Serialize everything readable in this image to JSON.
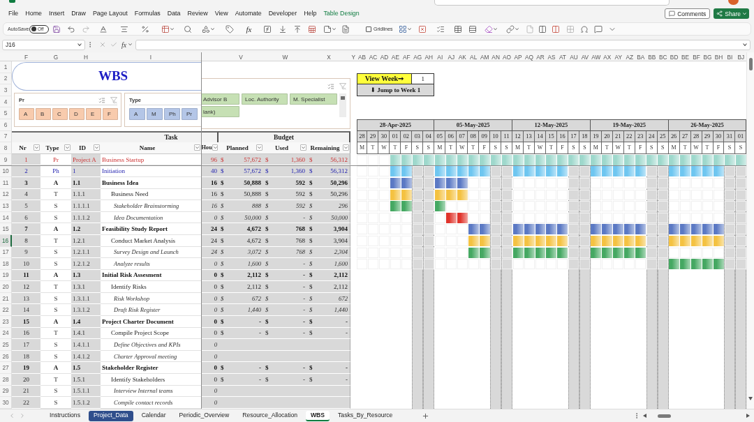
{
  "menu": {
    "tabs": [
      {
        "label": "File",
        "selected": false,
        "kind": "standard"
      },
      {
        "label": "Home",
        "selected": false,
        "kind": "standard"
      },
      {
        "label": "Insert",
        "selected": false,
        "kind": "standard"
      },
      {
        "label": "Draw",
        "selected": false,
        "kind": "standard"
      },
      {
        "label": "Page Layout",
        "selected": false,
        "kind": "standard"
      },
      {
        "label": "Formulas",
        "selected": false,
        "kind": "standard"
      },
      {
        "label": "Data",
        "selected": false,
        "kind": "standard"
      },
      {
        "label": "Review",
        "selected": false,
        "kind": "standard"
      },
      {
        "label": "View",
        "selected": false,
        "kind": "standard"
      },
      {
        "label": "Automate",
        "selected": false,
        "kind": "standard"
      },
      {
        "label": "Developer",
        "selected": false,
        "kind": "standard"
      },
      {
        "label": "Help",
        "selected": false,
        "kind": "standard"
      },
      {
        "label": "Table Design",
        "selected": false,
        "kind": "contextual"
      }
    ]
  },
  "header_buttons": [
    {
      "kind": "comments",
      "label": "Comments"
    },
    {
      "kind": "share",
      "label": "Share"
    }
  ],
  "toolbar": {
    "autosave": {
      "label": "AutoSave",
      "state": "Off",
      "on": false
    },
    "function_label": "fx",
    "gridlines": {
      "label": "Gridlines",
      "checked": false
    }
  },
  "formula_bar": {
    "name_box": "J16",
    "function_label": "fx"
  },
  "column_headers": [
    "F",
    "G",
    "H",
    "I",
    "V",
    "W",
    "X",
    "Y",
    "AB",
    "AC",
    "AD",
    "AE",
    "AF",
    "AG",
    "AH",
    "AI",
    "AJ",
    "AK",
    "AL",
    "AM",
    "AN",
    "AO",
    "AP",
    "AQ",
    "AR",
    "AS",
    "AT",
    "AU",
    "AV",
    "AW",
    "AX",
    "AY",
    "AZ",
    "BA",
    "BB",
    "BC",
    "BD",
    "BE",
    "BF",
    "BG",
    "BH",
    "BI",
    "BJ"
  ],
  "row_headers": [
    {
      "label": "1",
      "selected": false
    },
    {
      "label": "2",
      "selected": false
    },
    {
      "label": "3",
      "selected": false
    },
    {
      "label": "4",
      "selected": false
    },
    {
      "label": "5",
      "selected": false
    },
    {
      "label": "6",
      "selected": false
    },
    {
      "label": "7",
      "selected": false
    },
    {
      "label": "8",
      "selected": false
    },
    {
      "label": "9",
      "selected": false
    },
    {
      "label": "10",
      "selected": false
    },
    {
      "label": "11",
      "selected": false
    },
    {
      "label": "12",
      "selected": false
    },
    {
      "label": "13",
      "selected": false
    },
    {
      "label": "14",
      "selected": false
    },
    {
      "label": "15",
      "selected": false
    },
    {
      "label": "16",
      "selected": true
    },
    {
      "label": "17",
      "selected": false
    },
    {
      "label": "18",
      "selected": false
    },
    {
      "label": "19",
      "selected": false
    },
    {
      "label": "20",
      "selected": false
    },
    {
      "label": "21",
      "selected": false
    },
    {
      "label": "22",
      "selected": false
    },
    {
      "label": "23",
      "selected": false
    },
    {
      "label": "24",
      "selected": false
    },
    {
      "label": "25",
      "selected": false
    },
    {
      "label": "26",
      "selected": false
    },
    {
      "label": "27",
      "selected": false
    },
    {
      "label": "28",
      "selected": false
    },
    {
      "label": "29",
      "selected": false
    },
    {
      "label": "30",
      "selected": false
    }
  ],
  "title": "WBS",
  "slicers": [
    {
      "title": "Pr",
      "color": "#f8cbad",
      "items": [
        {
          "label": "A",
          "selected": true
        },
        {
          "label": "B",
          "selected": true
        },
        {
          "label": "C",
          "selected": true
        },
        {
          "label": "D",
          "selected": true
        },
        {
          "label": "E",
          "selected": true
        },
        {
          "label": "F",
          "selected": true
        }
      ]
    },
    {
      "title": "Type",
      "color": "#b4c6e7",
      "items": [
        {
          "label": "A",
          "selected": true
        },
        {
          "label": "M",
          "selected": true
        },
        {
          "label": "Ph",
          "selected": true
        },
        {
          "label": "Pr",
          "selected": true
        }
      ]
    },
    {
      "color": "#c6e0b4",
      "items": [
        {
          "label": "Advisor B",
          "selected": true
        },
        {
          "label": "Loc. Authority",
          "selected": true
        },
        {
          "label": "M. Specialist",
          "selected": true
        },
        {
          "label": "lank)",
          "selected": true
        }
      ]
    }
  ],
  "view_week": {
    "label": "View Week➞",
    "value": "1",
    "jump": "⬇ Jump to Week 1"
  },
  "table": {
    "groups": [
      {
        "label": "Task"
      },
      {
        "label": "Budget"
      }
    ],
    "columns": [
      {
        "label": "Nr"
      },
      {
        "label": "Type"
      },
      {
        "label": "ID"
      },
      {
        "label": "Name"
      },
      {
        "label": "Hou"
      },
      {
        "label": "Planned"
      },
      {
        "label": "Used"
      },
      {
        "label": "Remaining"
      }
    ],
    "rows": [
      {
        "kind": "project",
        "nr": "1",
        "type": "Pr",
        "id": "Project A",
        "name": "Business Startup",
        "hours": "96",
        "planned": {
          "symbol": "$",
          "amount": "57,672"
        },
        "used": {
          "symbol": "$",
          "amount": "1,360"
        },
        "remaining": {
          "symbol": "$",
          "amount": "56,312"
        },
        "bar": {
          "color": "#9ed8cc",
          "days": [
            false,
            false,
            false,
            true,
            true,
            true,
            true,
            true,
            true,
            true,
            true,
            true,
            true,
            true,
            true,
            true,
            true,
            true,
            true,
            true,
            true,
            true,
            true,
            true,
            true,
            true,
            true,
            true,
            true,
            true,
            true,
            true,
            true,
            true,
            true
          ]
        }
      },
      {
        "kind": "phase",
        "nr": "2",
        "type": "Ph",
        "id": "1",
        "name": "Initiation",
        "hours": "40",
        "planned": {
          "symbol": "$",
          "amount": "57,672"
        },
        "used": {
          "symbol": "$",
          "amount": "1,360"
        },
        "remaining": {
          "symbol": "$",
          "amount": "56,312"
        },
        "bar": {
          "color": "#6ec6f0",
          "days": [
            false,
            false,
            false,
            true,
            true,
            false,
            false,
            true,
            true,
            true,
            true,
            true,
            false,
            false,
            true,
            true,
            true,
            true,
            true,
            false,
            false,
            true,
            true,
            true,
            true,
            true,
            false,
            false,
            true,
            true,
            true,
            true,
            true,
            false,
            false
          ]
        }
      },
      {
        "kind": "activity",
        "nr": "3",
        "type": "A",
        "id": "1.1",
        "name": "Business Idea",
        "hours": "16",
        "planned": {
          "symbol": "$",
          "amount": "50,888"
        },
        "used": {
          "symbol": "$",
          "amount": "592"
        },
        "remaining": {
          "symbol": "$",
          "amount": "50,296"
        },
        "bar": {
          "color": "#5b79c4",
          "days": [
            false,
            false,
            false,
            true,
            true,
            false,
            false,
            true,
            true,
            true,
            false,
            false,
            false,
            false,
            false,
            false,
            false,
            false,
            false,
            false,
            false,
            false,
            false,
            false,
            false,
            false,
            false,
            false,
            false,
            false,
            false,
            false,
            false,
            false,
            false
          ]
        }
      },
      {
        "kind": "task",
        "nr": "4",
        "type": "T",
        "id": "1.1.1",
        "name": "Business Need",
        "hours": "16",
        "planned": {
          "symbol": "$",
          "amount": "50,888"
        },
        "used": {
          "symbol": "$",
          "amount": "592"
        },
        "remaining": {
          "symbol": "$",
          "amount": "50,296"
        },
        "bar": {
          "color": "#f4c242",
          "days": [
            false,
            false,
            false,
            true,
            true,
            false,
            false,
            true,
            true,
            true,
            false,
            false,
            false,
            false,
            false,
            false,
            false,
            false,
            false,
            false,
            false,
            false,
            false,
            false,
            false,
            false,
            false,
            false,
            false,
            false,
            false,
            false,
            false,
            false,
            false
          ]
        }
      },
      {
        "kind": "subtask",
        "nr": "5",
        "type": "S",
        "id": "1.1.1.1",
        "name": "Stakeholder Brainstorming",
        "hours": "16",
        "planned": {
          "symbol": "$",
          "amount": "888"
        },
        "used": {
          "symbol": "$",
          "amount": "592"
        },
        "remaining": {
          "symbol": "$",
          "amount": "296"
        },
        "bar": {
          "color": "#45a862",
          "days": [
            false,
            false,
            false,
            true,
            true,
            false,
            false,
            true,
            false,
            false,
            false,
            false,
            false,
            false,
            false,
            false,
            false,
            false,
            false,
            false,
            false,
            false,
            false,
            false,
            false,
            false,
            false,
            false,
            false,
            false,
            false,
            false,
            false,
            false,
            false
          ]
        }
      },
      {
        "kind": "subtask",
        "nr": "6",
        "type": "S",
        "id": "1.1.1.2",
        "name": "Idea Documentation",
        "hours": "0",
        "planned": {
          "symbol": "$",
          "amount": "50,000"
        },
        "used": {
          "symbol": "$",
          "amount": "-"
        },
        "remaining": {
          "symbol": "$",
          "amount": "50,000"
        },
        "bar": {
          "color": "#e0342c",
          "days": [
            false,
            false,
            false,
            false,
            false,
            false,
            false,
            false,
            true,
            true,
            false,
            false,
            false,
            false,
            false,
            false,
            false,
            false,
            false,
            false,
            false,
            false,
            false,
            false,
            false,
            false,
            false,
            false,
            false,
            false,
            false,
            false,
            false,
            false,
            false
          ]
        }
      },
      {
        "kind": "activity",
        "nr": "7",
        "type": "A",
        "id": "1.2",
        "name": "Feasibility Study Report",
        "hours": "24",
        "planned": {
          "symbol": "$",
          "amount": "4,672"
        },
        "used": {
          "symbol": "$",
          "amount": "768"
        },
        "remaining": {
          "symbol": "$",
          "amount": "3,904"
        },
        "bar": {
          "color": "#5b79c4",
          "days": [
            false,
            false,
            false,
            false,
            false,
            false,
            false,
            false,
            false,
            false,
            true,
            true,
            false,
            false,
            true,
            true,
            true,
            true,
            true,
            false,
            false,
            true,
            true,
            true,
            true,
            true,
            false,
            false,
            true,
            true,
            true,
            true,
            true,
            false,
            false
          ]
        }
      },
      {
        "kind": "task",
        "nr": "8",
        "type": "T",
        "id": "1.2.1",
        "name": "Conduct Market Analysis",
        "hours": "24",
        "planned": {
          "symbol": "$",
          "amount": "4,672"
        },
        "used": {
          "symbol": "$",
          "amount": "768"
        },
        "remaining": {
          "symbol": "$",
          "amount": "3,904"
        },
        "bar": {
          "color": "#f4c242",
          "days": [
            false,
            false,
            false,
            false,
            false,
            false,
            false,
            false,
            false,
            false,
            true,
            true,
            false,
            false,
            true,
            true,
            true,
            true,
            true,
            false,
            false,
            true,
            true,
            true,
            true,
            true,
            false,
            false,
            true,
            true,
            true,
            true,
            true,
            false,
            false
          ]
        }
      },
      {
        "kind": "subtask",
        "nr": "9",
        "type": "S",
        "id": "1.2.1.1",
        "name": "Survey Design and Launch",
        "hours": "24",
        "planned": {
          "symbol": "$",
          "amount": "3,072"
        },
        "used": {
          "symbol": "$",
          "amount": "768"
        },
        "remaining": {
          "symbol": "$",
          "amount": "2,304"
        },
        "bar": {
          "color": "#45a862",
          "days": [
            false,
            false,
            false,
            false,
            false,
            false,
            false,
            false,
            false,
            false,
            true,
            true,
            false,
            false,
            true,
            true,
            true,
            true,
            true,
            false,
            false,
            true,
            true,
            true,
            true,
            true,
            false,
            false,
            false,
            false,
            false,
            false,
            false,
            false,
            false
          ]
        }
      },
      {
        "kind": "subtask",
        "nr": "10",
        "type": "S",
        "id": "1.2.1.2",
        "name": "Analyze results",
        "hours": "0",
        "planned": {
          "symbol": "$",
          "amount": "1,600"
        },
        "used": {
          "symbol": "$",
          "amount": "-"
        },
        "remaining": {
          "symbol": "$",
          "amount": "1,600"
        },
        "bar": {
          "color": "#45a862",
          "days": [
            false,
            false,
            false,
            false,
            false,
            false,
            false,
            false,
            false,
            false,
            false,
            false,
            false,
            false,
            false,
            false,
            false,
            false,
            false,
            false,
            false,
            false,
            false,
            false,
            false,
            false,
            false,
            false,
            true,
            true,
            true,
            true,
            true,
            false,
            false
          ]
        }
      },
      {
        "kind": "activity",
        "nr": "11",
        "type": "A",
        "id": "1.3",
        "name": "Initial Risk Assesment",
        "hours": "0",
        "planned": {
          "symbol": "$",
          "amount": "2,112"
        },
        "used": {
          "symbol": "$",
          "amount": "-"
        },
        "remaining": {
          "symbol": "$",
          "amount": "2,112"
        }
      },
      {
        "kind": "task",
        "nr": "12",
        "type": "T",
        "id": "1.3.1",
        "name": "Identify Risks",
        "hours": "0",
        "planned": {
          "symbol": "$",
          "amount": "2,112"
        },
        "used": {
          "symbol": "$",
          "amount": "-"
        },
        "remaining": {
          "symbol": "$",
          "amount": "2,112"
        }
      },
      {
        "kind": "subtask",
        "nr": "13",
        "type": "S",
        "id": "1.3.1.1",
        "name": "Risk Workshop",
        "hours": "0",
        "planned": {
          "symbol": "$",
          "amount": "672"
        },
        "used": {
          "symbol": "$",
          "amount": "-"
        },
        "remaining": {
          "symbol": "$",
          "amount": "672"
        }
      },
      {
        "kind": "subtask",
        "nr": "14",
        "type": "S",
        "id": "1.3.1.2",
        "name": "Draft Risk Register",
        "hours": "0",
        "planned": {
          "symbol": "$",
          "amount": "1,440"
        },
        "used": {
          "symbol": "$",
          "amount": "-"
        },
        "remaining": {
          "symbol": "$",
          "amount": "1,440"
        }
      },
      {
        "kind": "activity",
        "nr": "15",
        "type": "A",
        "id": "1.4",
        "name": "Project Charter Document",
        "hours": "0",
        "planned": {
          "symbol": "$",
          "amount": "-"
        },
        "used": {
          "symbol": "$",
          "amount": "-"
        },
        "remaining": {
          "symbol": "$",
          "amount": "-"
        }
      },
      {
        "kind": "task",
        "nr": "16",
        "type": "T",
        "id": "1.4.1",
        "name": "Compile Project Scope",
        "hours": "0",
        "planned": {
          "symbol": "$",
          "amount": "-"
        },
        "used": {
          "symbol": "$",
          "amount": "-"
        },
        "remaining": {
          "symbol": "$",
          "amount": "-"
        }
      },
      {
        "kind": "subtask",
        "nr": "17",
        "type": "S",
        "id": "1.4.1.1",
        "name": "Define Objectives and KPIs",
        "hours": "0"
      },
      {
        "kind": "subtask",
        "nr": "18",
        "type": "S",
        "id": "1.4.1.2",
        "name": "Charter Approval meeting",
        "hours": "0"
      },
      {
        "kind": "activity",
        "nr": "19",
        "type": "A",
        "id": "1.5",
        "name": "Stakeholder Register",
        "hours": "0",
        "planned": {
          "symbol": "$",
          "amount": "-"
        },
        "used": {
          "symbol": "$",
          "amount": "-"
        },
        "remaining": {
          "symbol": "$",
          "amount": "-"
        }
      },
      {
        "kind": "task",
        "nr": "20",
        "type": "T",
        "id": "1.5.1",
        "name": "Identify Stakeholders",
        "hours": "0",
        "planned": {
          "symbol": "$",
          "amount": "-"
        },
        "used": {
          "symbol": "$",
          "amount": "-"
        },
        "remaining": {
          "symbol": "$",
          "amount": "-"
        }
      },
      {
        "kind": "subtask",
        "nr": "21",
        "type": "S",
        "id": "1.5.1.1",
        "name": "Interview Internal teams",
        "hours": "0"
      },
      {
        "kind": "subtask",
        "nr": "22",
        "type": "S",
        "id": "1.5.1.2",
        "name": "Compile contact records",
        "hours": "0"
      }
    ]
  },
  "timeline": {
    "weeks": [
      {
        "label": "28-Apr-2025"
      },
      {
        "label": "05-May-2025"
      },
      {
        "label": "12-May-2025"
      },
      {
        "label": "19-May-2025"
      },
      {
        "label": "26-May-2025"
      }
    ],
    "days": [
      {
        "date": "28",
        "weekday": "M",
        "kind": "workday"
      },
      {
        "date": "29",
        "weekday": "T",
        "kind": "workday"
      },
      {
        "date": "30",
        "weekday": "W",
        "kind": "workday"
      },
      {
        "date": "01",
        "weekday": "T",
        "kind": "workday"
      },
      {
        "date": "02",
        "weekday": "F",
        "kind": "workday"
      },
      {
        "date": "03",
        "weekday": "S",
        "kind": "weekend"
      },
      {
        "date": "04",
        "weekday": "S",
        "kind": "weekend"
      },
      {
        "date": "05",
        "weekday": "M",
        "kind": "workday"
      },
      {
        "date": "06",
        "weekday": "T",
        "kind": "workday"
      },
      {
        "date": "07",
        "weekday": "W",
        "kind": "workday"
      },
      {
        "date": "08",
        "weekday": "T",
        "kind": "workday"
      },
      {
        "date": "09",
        "weekday": "F",
        "kind": "workday"
      },
      {
        "date": "10",
        "weekday": "S",
        "kind": "weekend"
      },
      {
        "date": "11",
        "weekday": "S",
        "kind": "weekend"
      },
      {
        "date": "12",
        "weekday": "M",
        "kind": "workday"
      },
      {
        "date": "13",
        "weekday": "T",
        "kind": "workday"
      },
      {
        "date": "14",
        "weekday": "W",
        "kind": "workday"
      },
      {
        "date": "15",
        "weekday": "T",
        "kind": "workday"
      },
      {
        "date": "16",
        "weekday": "F",
        "kind": "workday"
      },
      {
        "date": "17",
        "weekday": "S",
        "kind": "weekend"
      },
      {
        "date": "18",
        "weekday": "S",
        "kind": "weekend"
      },
      {
        "date": "19",
        "weekday": "M",
        "kind": "workday"
      },
      {
        "date": "20",
        "weekday": "T",
        "kind": "workday"
      },
      {
        "date": "21",
        "weekday": "W",
        "kind": "workday"
      },
      {
        "date": "22",
        "weekday": "T",
        "kind": "workday"
      },
      {
        "date": "23",
        "weekday": "F",
        "kind": "workday"
      },
      {
        "date": "24",
        "weekday": "S",
        "kind": "weekend"
      },
      {
        "date": "25",
        "weekday": "S",
        "kind": "weekend"
      },
      {
        "date": "26",
        "weekday": "M",
        "kind": "workday"
      },
      {
        "date": "27",
        "weekday": "T",
        "kind": "workday"
      },
      {
        "date": "28",
        "weekday": "W",
        "kind": "workday"
      },
      {
        "date": "29",
        "weekday": "T",
        "kind": "workday"
      },
      {
        "date": "30",
        "weekday": "F",
        "kind": "workday"
      },
      {
        "date": "31",
        "weekday": "S",
        "kind": "weekend"
      },
      {
        "date": "01",
        "weekday": "S",
        "kind": "weekend"
      }
    ]
  },
  "sheet_tabs": [
    {
      "label": "Instructions",
      "selected": false
    },
    {
      "label": "Project_Data",
      "selected": false,
      "color": "#2f4e8c"
    },
    {
      "label": "Calendar",
      "selected": false
    },
    {
      "label": "Periodic_Overview",
      "selected": false
    },
    {
      "label": "Resource_Allocation",
      "selected": false
    },
    {
      "label": "WBS",
      "selected": true
    },
    {
      "label": "Tasks_By_Resource",
      "selected": false
    }
  ]
}
